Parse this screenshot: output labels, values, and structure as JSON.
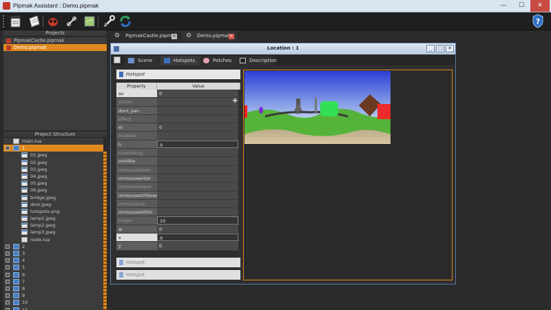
{
  "window": {
    "title": "Pipmak Assistant : Demo.pipmak",
    "min": "—",
    "max": "☐",
    "close": "✕"
  },
  "toolbar": {
    "help_label": "?"
  },
  "projects": {
    "header": "Projects",
    "items": [
      {
        "label": "PipmakCastle.pipmak",
        "active": false
      },
      {
        "label": "Demo.pipmak",
        "active": true
      }
    ]
  },
  "structure": {
    "header": "Project Structure",
    "rows": [
      {
        "label": "main.lua",
        "icon": "code",
        "indent": 1
      },
      {
        "label": "1",
        "icon": "folder",
        "indent": 0,
        "selected": true
      },
      {
        "label": "01.jpeg",
        "icon": "file",
        "indent": 2
      },
      {
        "label": "02.jpeg",
        "icon": "file",
        "indent": 2
      },
      {
        "label": "03.jpeg",
        "icon": "file",
        "indent": 2
      },
      {
        "label": "04.jpeg",
        "icon": "file",
        "indent": 2
      },
      {
        "label": "05.jpeg",
        "icon": "file",
        "indent": 2
      },
      {
        "label": "06.jpeg",
        "icon": "file",
        "indent": 2
      },
      {
        "label": "bridge.jpeg",
        "icon": "file",
        "indent": 2
      },
      {
        "label": "door.jpeg",
        "icon": "file",
        "indent": 2
      },
      {
        "label": "hotspots.png",
        "icon": "file",
        "indent": 2
      },
      {
        "label": "lamp1.jpeg",
        "icon": "file",
        "indent": 2
      },
      {
        "label": "lamp2.jpeg",
        "icon": "file",
        "indent": 2
      },
      {
        "label": "lamp3.jpeg",
        "icon": "file",
        "indent": 2
      },
      {
        "label": "node.lua",
        "icon": "code",
        "indent": 2
      },
      {
        "label": "2",
        "icon": "folder",
        "indent": 0
      },
      {
        "label": "3",
        "icon": "folder",
        "indent": 0
      },
      {
        "label": "4",
        "icon": "folder",
        "indent": 0
      },
      {
        "label": "5",
        "icon": "folder",
        "indent": 0
      },
      {
        "label": "6",
        "icon": "folder",
        "indent": 0
      },
      {
        "label": "7",
        "icon": "folder",
        "indent": 0
      },
      {
        "label": "8",
        "icon": "folder",
        "indent": 0
      },
      {
        "label": "9",
        "icon": "folder",
        "indent": 0
      },
      {
        "label": "10",
        "icon": "folder",
        "indent": 0
      },
      {
        "label": "11",
        "icon": "folder",
        "indent": 0
      }
    ]
  },
  "doc_tabs": [
    {
      "label": "PipmakCastle.pipmak",
      "close": "✕"
    },
    {
      "label": "Demo.pipmak",
      "close": "✕"
    }
  ],
  "inner_window": {
    "title": "Location : 1",
    "min": "_",
    "max": "□",
    "close": "✕",
    "tabs": [
      "Scene",
      "Hotspots",
      "Patches",
      "Description"
    ]
  },
  "hotspot": {
    "header": "Hotspot",
    "col_property": "Property",
    "col_value": "Value",
    "rows": [
      {
        "key": "az",
        "value": "0",
        "style": "light"
      },
      {
        "key": "cursor",
        "value": "",
        "style": "dim",
        "plus": true
      },
      {
        "key": "dont_pan",
        "value": "",
        "style": "normal"
      },
      {
        "key": "effect",
        "value": "",
        "style": "dim"
      },
      {
        "key": "el",
        "value": "0",
        "style": "normal"
      },
      {
        "key": "enabled",
        "value": "",
        "style": "dim"
      },
      {
        "key": "h",
        "value": "0",
        "style": "normal",
        "set": true
      },
      {
        "key": "onenddrag",
        "value": "",
        "style": "dim"
      },
      {
        "key": "onhilite",
        "value": "",
        "style": "normal"
      },
      {
        "key": "onmousedown",
        "value": "",
        "style": "dim"
      },
      {
        "key": "onmouseenter",
        "value": "",
        "style": "normal"
      },
      {
        "key": "onmouseleave",
        "value": "",
        "style": "dim"
      },
      {
        "key": "onmousestilldown",
        "value": "",
        "style": "normal"
      },
      {
        "key": "onmouseup",
        "value": "",
        "style": "dim"
      },
      {
        "key": "onmousewithin",
        "value": "",
        "style": "normal"
      },
      {
        "key": "target",
        "value": "10",
        "style": "dim",
        "set": true
      },
      {
        "key": "w",
        "value": "0",
        "style": "normal"
      },
      {
        "key": "x",
        "value": "0",
        "style": "light",
        "set": true
      },
      {
        "key": "y",
        "value": "0",
        "style": "normal"
      }
    ],
    "collapsed": [
      "Hotspot",
      "Hotspot"
    ]
  }
}
